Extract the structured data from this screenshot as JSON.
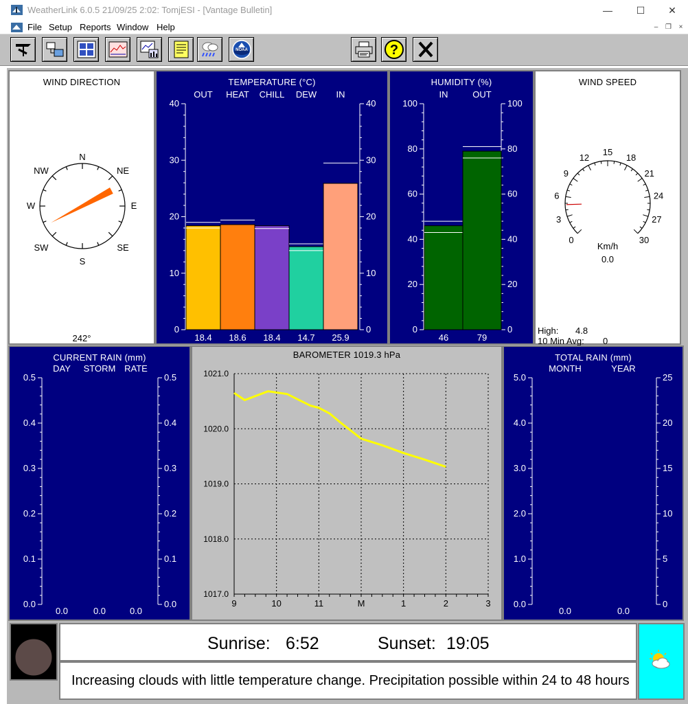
{
  "window": {
    "title": "WeatherLink 6.0.5  21/09/25   2:02: TomjESI - [Vantage Bulletin]",
    "minimize_glyph": "—",
    "maximize_glyph": "☐",
    "close_glyph": "✕"
  },
  "menu": {
    "items": [
      "File",
      "Setup",
      "Reports",
      "Window",
      "Help"
    ],
    "mdi_minimize": "–",
    "mdi_restore": "❐",
    "mdi_close": "×"
  },
  "toolbar": {
    "buttons": [
      "wind-vane-icon",
      "station-icon",
      "bulletin-icon",
      "strip-chart-icon",
      "graph-icon",
      "notes-icon",
      "weather-cloud-icon",
      "noaa-icon",
      "printer-icon",
      "help-icon",
      "close-icon"
    ],
    "noaa_label": "NOAA"
  },
  "wind_direction": {
    "title": "WIND DIRECTION",
    "labels": {
      "n": "N",
      "ne": "NE",
      "e": "E",
      "se": "SE",
      "s": "S",
      "sw": "SW",
      "w": "W",
      "nw": "NW"
    },
    "bearing_deg": 242,
    "reading": "242°",
    "needle_color": "#ff6600"
  },
  "temperature": {
    "title": "TEMPERATURE  (°C)",
    "ticks": [
      "40",
      "30",
      "20",
      "10",
      "0"
    ],
    "bars": [
      {
        "label": "OUT",
        "value": "18.4",
        "v": 18.4,
        "hi": 19.0,
        "lo": 18.0,
        "color": "#ffc000"
      },
      {
        "label": "HEAT",
        "value": "18.6",
        "v": 18.6,
        "hi": 19.4,
        "lo": null,
        "color": "#ff7f0e"
      },
      {
        "label": "CHILL",
        "value": "18.4",
        "v": 18.4,
        "hi": null,
        "lo": 17.9,
        "color": "#7a40c8"
      },
      {
        "label": "DEW",
        "value": "14.7",
        "v": 14.7,
        "hi": 15.2,
        "lo": 14.0,
        "color": "#20d0a0"
      },
      {
        "label": "IN",
        "value": "25.9",
        "v": 25.9,
        "hi": 29.5,
        "lo": null,
        "color": "#ffa07a"
      }
    ],
    "max": 40
  },
  "humidity": {
    "title": "HUMIDITY  (%)",
    "ticks": [
      "100",
      "80",
      "60",
      "40",
      "20",
      "0"
    ],
    "bars": [
      {
        "label": "IN",
        "value": "46",
        "v": 46,
        "hi": 48,
        "lo": 43,
        "color": "#006400"
      },
      {
        "label": "OUT",
        "value": "79",
        "v": 79,
        "hi": 81,
        "lo": 76,
        "color": "#006400"
      }
    ],
    "max": 100
  },
  "wind_speed": {
    "title": "WIND SPEED",
    "ticks": [
      "0",
      "3",
      "6",
      "9",
      "12",
      "15",
      "18",
      "21",
      "24",
      "27",
      "30"
    ],
    "unit": "Km/h",
    "reading": "0.0",
    "value": 0.0,
    "high": 4.8,
    "high_label": "High:",
    "high_value": "4.8",
    "avg_label": "10 Min Avg:",
    "avg_value": "0"
  },
  "current_rain": {
    "title": "CURRENT RAIN  (mm)",
    "columns": [
      "DAY",
      "STORM",
      "RATE"
    ],
    "ticks": [
      "0.5",
      "0.4",
      "0.3",
      "0.2",
      "0.1",
      "0.0"
    ],
    "values": [
      "0.0",
      "0.0",
      "0.0"
    ]
  },
  "barometer": {
    "title": "BAROMETER 1019.3 hPa",
    "y_ticks": [
      "1021.0",
      "1020.0",
      "1019.0",
      "1018.0",
      "1017.0"
    ],
    "x_ticks": [
      "9",
      "10",
      "11",
      "M",
      "1",
      "2",
      "3"
    ]
  },
  "total_rain": {
    "title": "TOTAL RAIN  (mm)",
    "columns": [
      "MONTH",
      "YEAR"
    ],
    "left_ticks": [
      "5.0",
      "4.0",
      "3.0",
      "2.0",
      "1.0",
      "0.0"
    ],
    "right_ticks": [
      "25",
      "20",
      "15",
      "10",
      "5",
      "0"
    ],
    "values": [
      "0.0",
      "0.0"
    ]
  },
  "sun": {
    "sunrise_label": "Sunrise:",
    "sunrise": "6:52",
    "sunset_label": "Sunset:",
    "sunset": "19:05"
  },
  "forecast": {
    "text": "Increasing clouds with little temperature change.  Precipitation possible within 24 to 48 hours",
    "icon": "partly-cloudy-icon",
    "bg_color": "#00ffff"
  },
  "moon": {
    "icon": "moon-phase-icon",
    "color": "#5c4a48"
  },
  "chart_data": {
    "type": "line",
    "title": "BAROMETER 1019.3 hPa",
    "xlabel": "",
    "ylabel": "",
    "x": [
      9.0,
      9.25,
      9.8,
      10.25,
      10.8,
      11.0,
      11.25,
      11.5,
      12.0,
      12.5,
      13.0,
      13.5,
      14.0
    ],
    "series": [
      {
        "values": [
          1020.65,
          1020.52,
          1020.68,
          1020.63,
          1020.42,
          1020.38,
          1020.28,
          1020.12,
          1019.82,
          1019.7,
          1019.56,
          1019.44,
          1019.31
        ]
      }
    ],
    "xlim": [
      9,
      15
    ],
    "ylim": [
      1017.0,
      1021.0
    ],
    "x_tick_labels": [
      "9",
      "10",
      "11",
      "M",
      "1",
      "2",
      "3"
    ],
    "grid": true,
    "line_color": "#ffff00"
  }
}
